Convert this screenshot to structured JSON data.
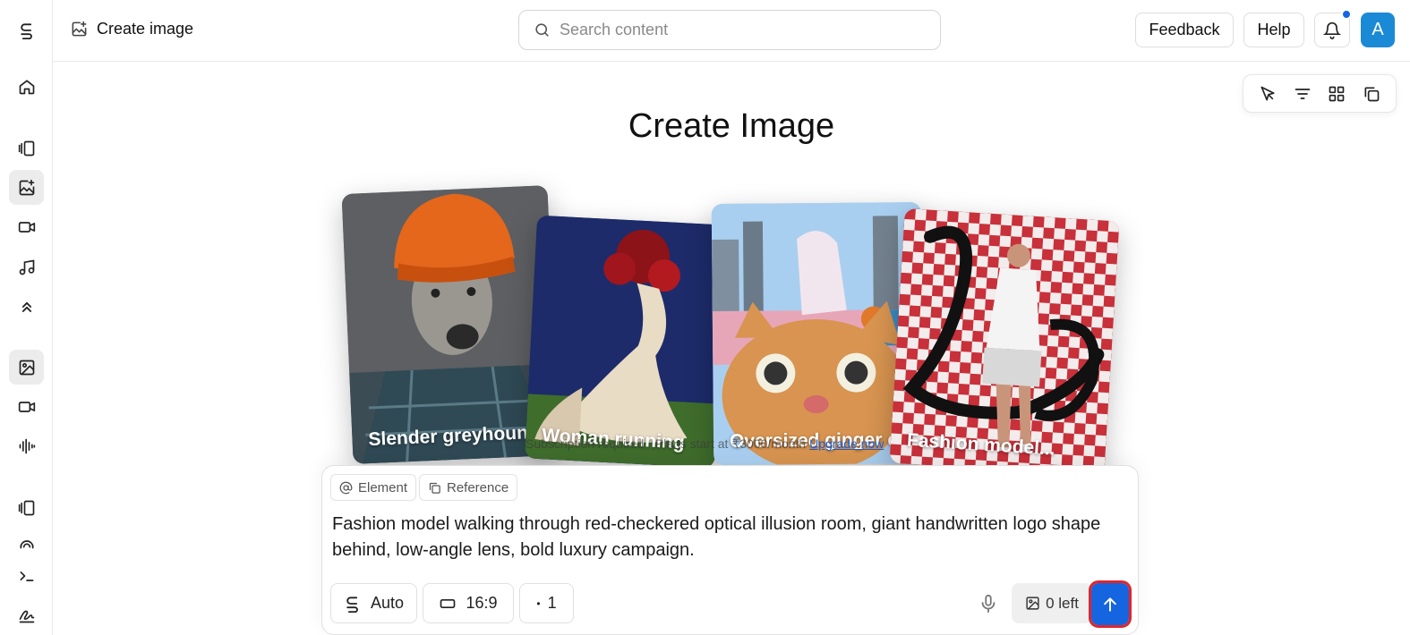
{
  "header": {
    "breadcrumb": "Create image",
    "search_placeholder": "Search content",
    "feedback_label": "Feedback",
    "help_label": "Help",
    "avatar_initial": "A"
  },
  "sidebar": {
    "items": [
      {
        "name": "logo-icon"
      },
      {
        "name": "home-icon"
      },
      {
        "name": "library-icon"
      },
      {
        "name": "create-image-icon",
        "active": true
      },
      {
        "name": "video-icon"
      },
      {
        "name": "music-icon"
      },
      {
        "name": "expand-up-icon"
      },
      {
        "name": "image-icon",
        "active": true
      },
      {
        "name": "video-camera-icon"
      },
      {
        "name": "audio-wave-icon"
      },
      {
        "name": "library-2-icon"
      },
      {
        "name": "link-icon"
      },
      {
        "name": "terminal-icon"
      },
      {
        "name": "signature-icon"
      }
    ]
  },
  "palette": [
    "pointer-icon",
    "filter-icon",
    "grid-icon",
    "copy-icon"
  ],
  "main": {
    "title": "Create Image",
    "cards": [
      {
        "label": "Slender greyhound"
      },
      {
        "label": "Woman running"
      },
      {
        "label": "Oversized ginger c..."
      },
      {
        "label": "Fashion model..."
      }
    ],
    "subscription_text": "Subscription required · Plans start at ₹3000/month",
    "upgrade_link": "Upgrade now"
  },
  "prompt": {
    "element_label": "Element",
    "reference_label": "Reference",
    "text": "Fashion model walking through red-checkered optical illusion room, giant handwritten logo shape behind, low-angle lens, bold luxury campaign.",
    "model_label": "Auto",
    "ratio_label": "16:9",
    "count_label": "1",
    "credits_label": "0 left"
  },
  "colors": {
    "accent": "#1565e0",
    "avatar": "#1a8ad6",
    "highlight": "#e0252b"
  }
}
